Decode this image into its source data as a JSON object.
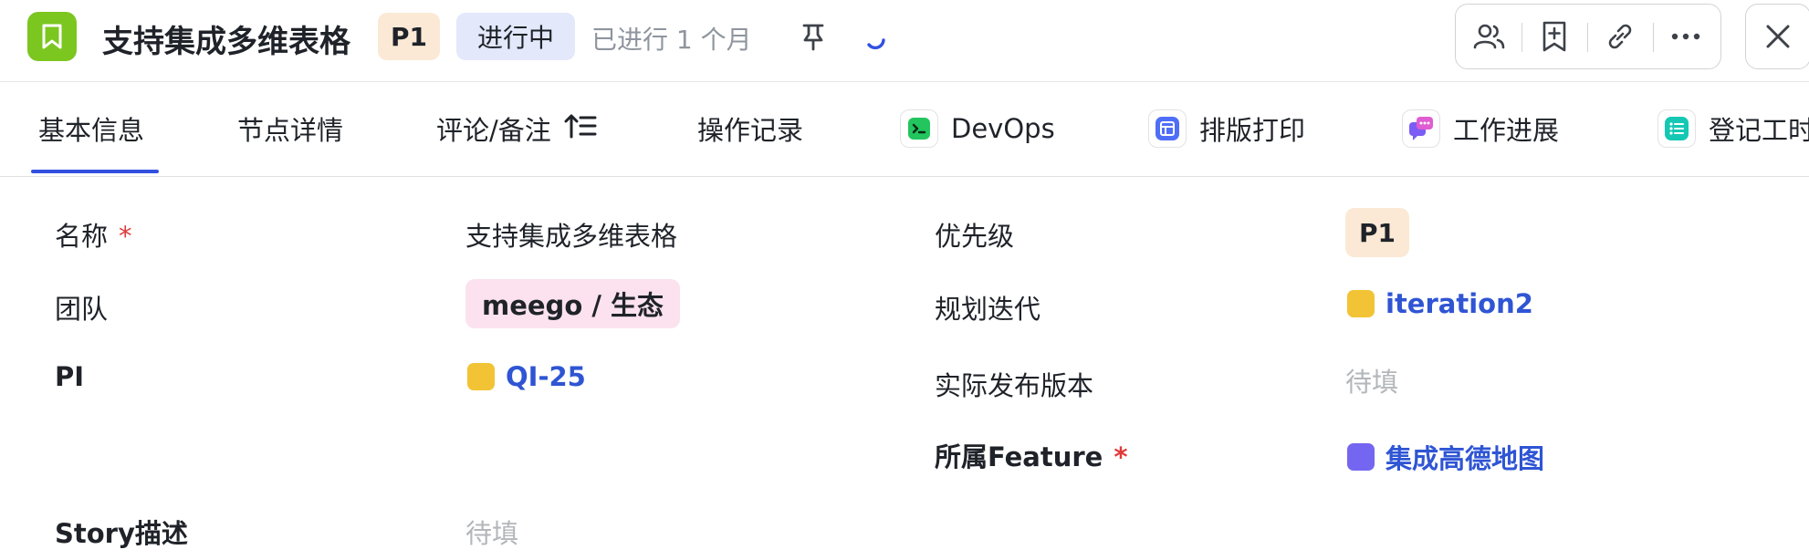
{
  "header": {
    "title": "支持集成多维表格",
    "priority": "P1",
    "status": "进行中",
    "duration": "已进行 1 个月",
    "app_icon": "bookmark-icon",
    "colors": {
      "app_icon_bg": "#7cc620",
      "priority_bg": "#fbe9d5",
      "status_bg": "#e3e8fb",
      "accent": "#3250e0",
      "link": "#2f55d4",
      "required": "#e03a3a"
    },
    "actions": [
      "members-icon",
      "add-note-icon",
      "link-icon",
      "more-icon"
    ],
    "close_icon": "close-icon"
  },
  "tabs": [
    {
      "label": "基本信息",
      "active": true
    },
    {
      "label": "节点详情"
    },
    {
      "label": "评论/备注",
      "icon": "sort-icon"
    },
    {
      "label": "操作记录"
    },
    {
      "label": "DevOps",
      "icon": "terminal-icon"
    },
    {
      "label": "排版打印",
      "icon": "layout-icon"
    },
    {
      "label": "工作进展",
      "icon": "chat-icon"
    },
    {
      "label": "登记工时",
      "icon": "list-icon"
    }
  ],
  "form": {
    "left": {
      "name_label": "名称",
      "name_required": "*",
      "name_value": "支持集成多维表格",
      "team_label": "团队",
      "team_value": "meego / 生态",
      "pi_label": "PI",
      "pi_value": "QI-25",
      "story_label": "Story描述",
      "story_placeholder": "待填"
    },
    "right": {
      "priority_label": "优先级",
      "priority_value": "P1",
      "iteration_label": "规划迭代",
      "iteration_value": "iteration2",
      "release_label": "实际发布版本",
      "release_placeholder": "待填",
      "feature_label": "所属Feature",
      "feature_required": "*",
      "feature_value": "集成高德地图"
    }
  }
}
